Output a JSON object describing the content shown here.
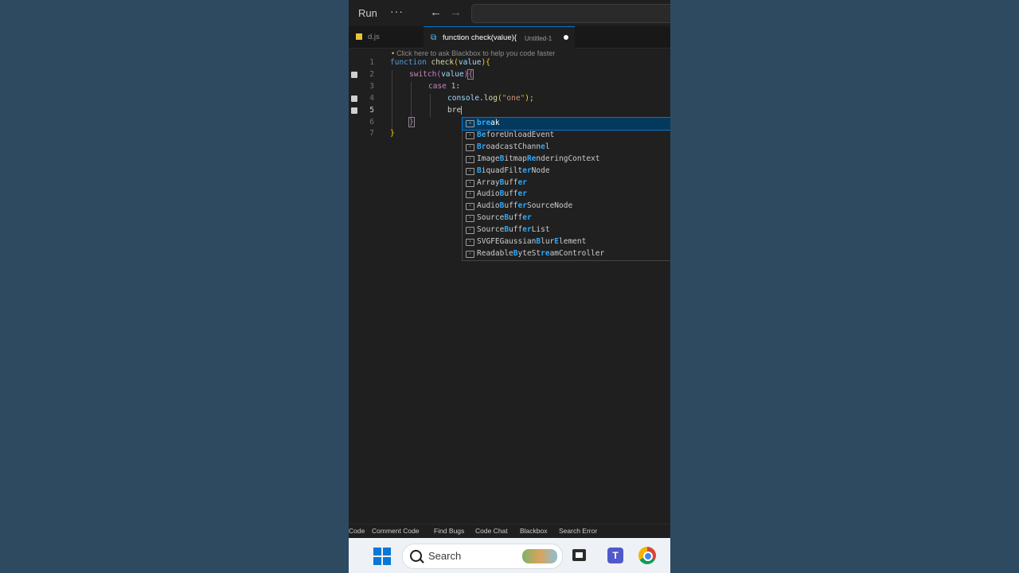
{
  "titlebar": {
    "run_label": "Run",
    "more_label": "···",
    "back_glyph": "←",
    "forward_glyph": "→"
  },
  "tabs": [
    {
      "label": "d.js",
      "icon": "js-file-icon"
    },
    {
      "label": "function check(value){",
      "description": "Untitled-1",
      "dirty": true,
      "icon": "js-function-icon"
    }
  ],
  "editor": {
    "hint": "Click here to ask Blackbox to help you code faster",
    "line_numbers": [
      "1",
      "2",
      "3",
      "4",
      "5",
      "6",
      "7"
    ],
    "current_line": "5",
    "lines": {
      "l1_kw": "function",
      "l1_fn": "check",
      "l1_p": "(",
      "l1_var": "value",
      "l1_close": "){",
      "l2_kw": "switch",
      "l2_open": "(",
      "l2_var": "value",
      "l2_close": ")",
      "l2_brace": "{",
      "l3_kw": "case",
      "l3_num": "1",
      "l3_colon": ":",
      "l4_obj": "console",
      "l4_dot": ".",
      "l4_fn": "log",
      "l4_open": "(",
      "l4_str": "\"one\"",
      "l4_close": ");",
      "l5_text": "bre",
      "l6_brace": "}",
      "l7_brace": "}"
    }
  },
  "suggest": {
    "items": [
      {
        "hl1": "bre",
        "rest1": "ak",
        "selected": true
      },
      {
        "hl1": "B",
        "rest1": "",
        "hl2": "e",
        "rest2": "foreUnloadEvent"
      },
      {
        "hl1": "Br",
        "rest1": "oadcastChann",
        "hl2": "e",
        "rest2": "l"
      },
      {
        "pre": "Image",
        "hl1": "B",
        "rest1": "itmap",
        "hl2": "Re",
        "rest2": "nderingContext"
      },
      {
        "hl1": "B",
        "rest1": "iquadFilt",
        "hl2": "er",
        "rest2": "Node"
      },
      {
        "pre": "Array",
        "hl1": "B",
        "rest1": "uff",
        "hl2": "er",
        "rest2": ""
      },
      {
        "pre": "Audio",
        "hl1": "B",
        "rest1": "uff",
        "hl2": "er",
        "rest2": ""
      },
      {
        "pre": "Audio",
        "hl1": "B",
        "rest1": "uff",
        "hl2": "er",
        "rest2": "SourceNode"
      },
      {
        "pre": "Source",
        "hl1": "B",
        "rest1": "uff",
        "hl2": "er",
        "rest2": ""
      },
      {
        "pre": "Source",
        "hl1": "B",
        "rest1": "uff",
        "hl2": "er",
        "rest2": "List"
      },
      {
        "pre": "SVGFEGaussian",
        "hl1": "B",
        "rest1": "lur",
        "hl2": "E",
        "rest2": "lement"
      },
      {
        "pre": "Readable",
        "hl1": "B",
        "rest1": "yteSt",
        "hl2": "re",
        "rest2": "amController"
      }
    ]
  },
  "blackbox_bar": [
    "Code",
    "Comment Code",
    "Find Bugs",
    "Code Chat",
    "Blackbox",
    "Search Error"
  ],
  "taskbar": {
    "search_label": "Search",
    "teams_glyph": "T"
  }
}
